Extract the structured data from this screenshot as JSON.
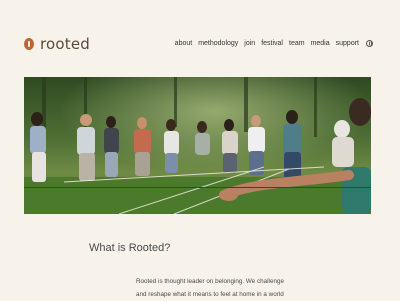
{
  "brand": {
    "name": "rooted"
  },
  "nav": {
    "items": [
      "about",
      "methodology",
      "join",
      "festival",
      "team",
      "media",
      "support"
    ]
  },
  "about": {
    "heading": "What is Rooted?",
    "line1": "Rooted is thought leader on belonging. We challenge",
    "line2": "and reshape what it means to feel at home in a world"
  },
  "colors": {
    "background": "#f8f3ea",
    "logo_mark": "#b8663a",
    "text": "#3b3b3b"
  },
  "icons": {
    "language": "globe-icon",
    "logo": "seed-logo-icon"
  }
}
